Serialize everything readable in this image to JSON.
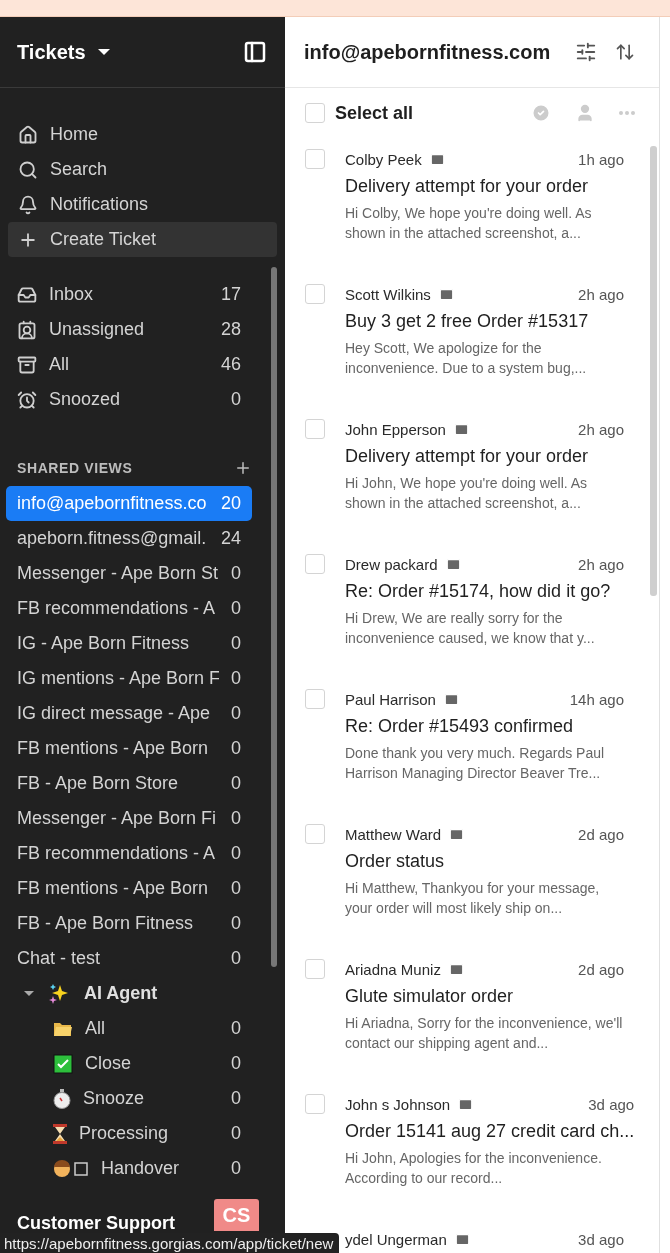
{
  "header": {
    "title": "Tickets"
  },
  "nav": [
    {
      "kind": "home",
      "label": "Home",
      "highlighted": false
    },
    {
      "kind": "search",
      "label": "Search",
      "highlighted": false
    },
    {
      "kind": "bell",
      "label": "Notifications",
      "highlighted": false
    },
    {
      "kind": "plus",
      "label": "Create Ticket",
      "highlighted": true
    }
  ],
  "folders": [
    {
      "kind": "inbox",
      "label": "Inbox",
      "count": "17"
    },
    {
      "kind": "badge",
      "label": "Unassigned",
      "count": "28"
    },
    {
      "kind": "tray",
      "label": "All",
      "count": "46"
    },
    {
      "kind": "alarm",
      "label": "Snoozed",
      "count": "0"
    }
  ],
  "shared_views": {
    "title": "SHARED VIEWS",
    "views": [
      {
        "label": "info@apebornfitness.co",
        "count": "20",
        "selected": true
      },
      {
        "label": "apeborn.fitness@gmail.",
        "count": "24",
        "selected": false
      },
      {
        "label": "Messenger - Ape Born St",
        "count": "0",
        "selected": false
      },
      {
        "label": "FB recommendations - A",
        "count": "0",
        "selected": false
      },
      {
        "label": "IG - Ape Born Fitness",
        "count": "0",
        "selected": false
      },
      {
        "label": "IG mentions - Ape Born F",
        "count": "0",
        "selected": false
      },
      {
        "label": "IG direct message - Ape",
        "count": "0",
        "selected": false
      },
      {
        "label": "FB mentions - Ape Born",
        "count": "0",
        "selected": false
      },
      {
        "label": "FB - Ape Born Store",
        "count": "0",
        "selected": false
      },
      {
        "label": "Messenger - Ape Born Fi",
        "count": "0",
        "selected": false
      },
      {
        "label": "FB recommendations - A",
        "count": "0",
        "selected": false
      },
      {
        "label": "FB mentions - Ape Born",
        "count": "0",
        "selected": false
      },
      {
        "label": "FB - Ape Born Fitness",
        "count": "0",
        "selected": false
      },
      {
        "label": "Chat - test",
        "count": "0",
        "selected": false
      }
    ],
    "ai_agent": {
      "label": "AI Agent",
      "expanded": true,
      "children": [
        {
          "kind": "folder",
          "label": "All",
          "count": "0"
        },
        {
          "kind": "check",
          "label": "Close",
          "count": "0"
        },
        {
          "kind": "stopwatch",
          "label": "Snooze",
          "count": "0"
        },
        {
          "kind": "hourglass",
          "label": "Processing",
          "count": "0"
        },
        {
          "kind": "person",
          "label": "Handover",
          "count": "0"
        }
      ]
    }
  },
  "footer": {
    "team": "Customer Support",
    "avatar": "CS"
  },
  "list": {
    "title": "info@apebornfitness.com",
    "select_all": {
      "label": "Select all",
      "checked": false
    },
    "tickets": [
      {
        "sender": "Colby Peek",
        "time": "1h ago",
        "subject": "Delivery attempt for your order",
        "preview": "Hi Colby, We hope you're doing well. As shown in the attached screenshot, a...",
        "checked": false
      },
      {
        "sender": "Scott Wilkins",
        "time": "2h ago",
        "subject": "Buy 3 get 2 free Order #15317",
        "preview": "Hey Scott, We apologize for the inconvenience. Due to a system bug,...",
        "checked": false
      },
      {
        "sender": "John Epperson",
        "time": "2h ago",
        "subject": "Delivery attempt for your order",
        "preview": "Hi John, We hope you're doing well. As shown in the attached screenshot, a...",
        "checked": false
      },
      {
        "sender": "Drew packard",
        "time": "2h ago",
        "subject": "Re: Order #15174, how did it go?",
        "preview": "Hi Drew, We are really sorry for the inconvenience caused, we know that y...",
        "checked": false
      },
      {
        "sender": "Paul Harrison",
        "time": "14h ago",
        "subject": "Re: Order #15493 confirmed",
        "preview": "Done thank you very much. Regards Paul Harrison Managing Director Beaver Tre...",
        "checked": false
      },
      {
        "sender": "Matthew Ward",
        "time": "2d ago",
        "subject": "Order status",
        "preview": "Hi Matthew, Thankyou for your message, your order will most likely ship on...",
        "checked": false
      },
      {
        "sender": "Ariadna Muniz",
        "time": "2d ago",
        "subject": "Glute simulator order",
        "preview": "Hi Ariadna, Sorry for the inconvenience, we'll contact our shipping agent and...",
        "checked": false
      },
      {
        "sender": "John s Johnson",
        "time": "3d ago",
        "subject": "Order 15141 aug 27 credit card ch...",
        "preview": "Hi John, Apologies for the inconvenience. According to our record...",
        "checked": false
      },
      {
        "sender": "ydel Ungerman",
        "time": "3d ago"
      }
    ]
  },
  "status_url": "https://apebornfitness.gorgias.com/app/ticket/new"
}
